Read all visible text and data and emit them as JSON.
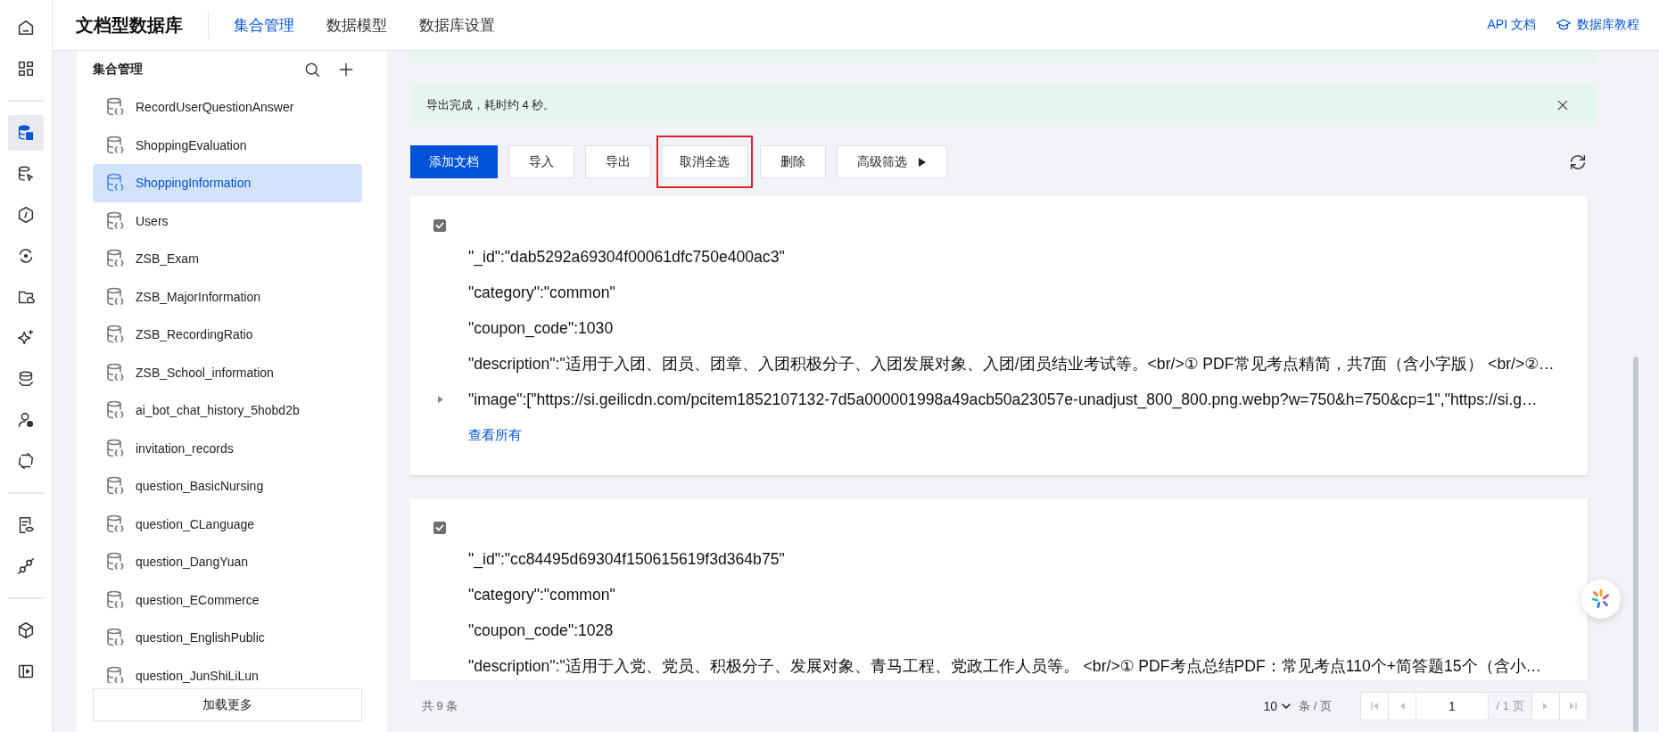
{
  "rail": {
    "groups": [
      [
        {
          "selected": false
        },
        {
          "selected": false
        }
      ],
      [
        {
          "selected": true
        },
        {
          "selected": false
        },
        {
          "selected": false
        },
        {
          "selected": false
        },
        {
          "selected": false
        },
        {
          "selected": false
        },
        {
          "selected": false
        },
        {
          "selected": false
        },
        {
          "selected": false
        }
      ],
      [
        {
          "selected": false
        },
        {
          "selected": false
        }
      ],
      [
        {
          "selected": false
        },
        {
          "selected": false
        }
      ]
    ]
  },
  "header": {
    "title": "文档型数据库",
    "tabs": [
      {
        "label": "集合管理",
        "selected": true
      },
      {
        "label": "数据模型",
        "selected": false
      },
      {
        "label": "数据库设置",
        "selected": false
      }
    ],
    "links": [
      {
        "label": "API 文档",
        "kind": "plain"
      },
      {
        "label": "数据库教程",
        "kind": "with_icon"
      }
    ]
  },
  "sidebar": {
    "title": "集合管理",
    "items": [
      {
        "name": "RecordUserQuestionAnswer",
        "selected": false
      },
      {
        "name": "ShoppingEvaluation",
        "selected": false
      },
      {
        "name": "ShoppingInformation",
        "selected": true
      },
      {
        "name": "Users",
        "selected": false
      },
      {
        "name": "ZSB_Exam",
        "selected": false
      },
      {
        "name": "ZSB_MajorInformation",
        "selected": false
      },
      {
        "name": "ZSB_RecordingRatio",
        "selected": false
      },
      {
        "name": "ZSB_School_information",
        "selected": false
      },
      {
        "name": "ai_bot_chat_history_5hobd2b",
        "selected": false
      },
      {
        "name": "invitation_records",
        "selected": false
      },
      {
        "name": "question_BasicNursing",
        "selected": false
      },
      {
        "name": "question_CLanguage",
        "selected": false
      },
      {
        "name": "question_DangYuan",
        "selected": false
      },
      {
        "name": "question_ECommerce",
        "selected": false
      },
      {
        "name": "question_EnglishPublic",
        "selected": false
      },
      {
        "name": "question_JunShiLiLun",
        "selected": false
      }
    ],
    "load_more": "加载更多"
  },
  "alert": {
    "message": "导出完成，耗时约 4 秒。"
  },
  "toolbar": {
    "buttons": [
      {
        "label": "添加文档",
        "kind": "primary",
        "highlighted": false
      },
      {
        "label": "导入",
        "kind": "default",
        "highlighted": false
      },
      {
        "label": "导出",
        "kind": "default",
        "highlighted": false
      },
      {
        "label": "取消全选",
        "kind": "default",
        "highlighted": true
      },
      {
        "label": "删除",
        "kind": "default",
        "highlighted": false
      },
      {
        "label": "高级筛选",
        "kind": "dropdown",
        "highlighted": false
      }
    ]
  },
  "documents": [
    {
      "checked": true,
      "fields": [
        {
          "text": "\"_id\":\"dab5292a69304f00061dfc750e400ac3\"",
          "expandable": false
        },
        {
          "text": "\"category\":\"common\"",
          "expandable": false
        },
        {
          "text": "\"coupon_code\":1030",
          "expandable": false
        },
        {
          "text": "\"description\":\"适用于入团、团员、团章、入团积极分子、入团发展对象、入团/团员结业考试等。<br/>① PDF常见考点精简，共7面（含小字版） <br/>②…",
          "expandable": false
        },
        {
          "text": "\"image\":[\"https://si.geilicdn.com/pcitem1852107132-7d5a000001998a49acb50a23057e-unadjust_800_800.png.webp?w=750&h=750&cp=1\",\"https://si.g…",
          "expandable": true
        }
      ],
      "view_all": "查看所有"
    },
    {
      "checked": true,
      "fields": [
        {
          "text": "\"_id\":\"cc84495d69304f150615619f3d364b75\"",
          "expandable": false
        },
        {
          "text": "\"category\":\"common\"",
          "expandable": false
        },
        {
          "text": "\"coupon_code\":1028",
          "expandable": false
        },
        {
          "text": "\"description\":\"适用于入党、党员、积极分子、发展对象、青马工程、党政工作人员等。 <br/>① PDF考点总结PDF：常见考点110个+简答题15个（含小…",
          "expandable": false
        }
      ]
    }
  ],
  "footer": {
    "total": "共 9 条",
    "page_size": "10",
    "page_size_unit": "条 / 页",
    "page": "1",
    "page_total": "/ 1 页"
  }
}
